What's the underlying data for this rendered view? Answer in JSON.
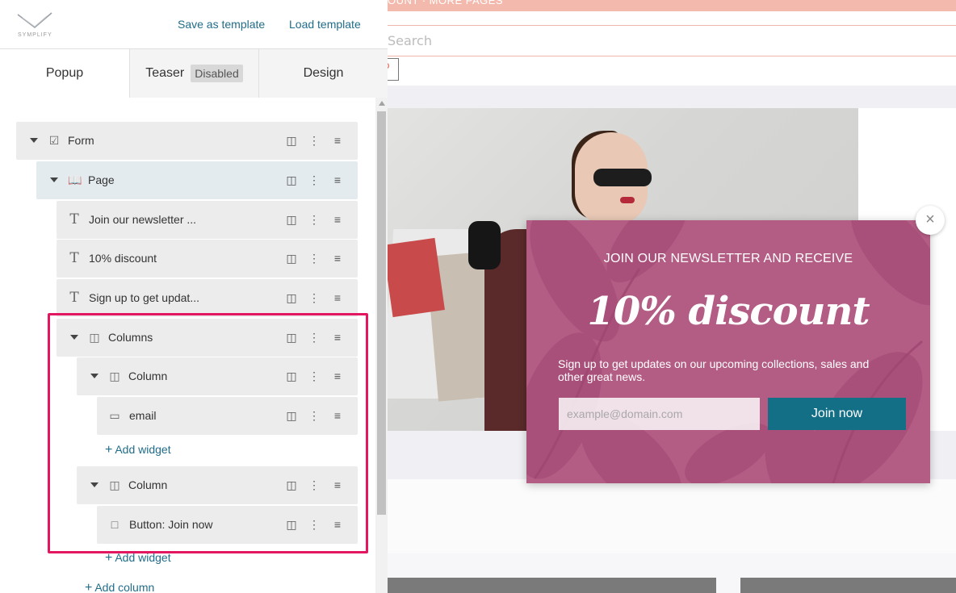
{
  "header": {
    "logo_text": "SYMPLIFY",
    "save_template": "Save as template",
    "load_template": "Load template"
  },
  "tabs": [
    {
      "label": "Popup"
    },
    {
      "label": "Teaser",
      "badge": "Disabled"
    },
    {
      "label": "Design"
    }
  ],
  "tree": {
    "form": "Form",
    "page": "Page",
    "text1": "Join our newsletter ...",
    "text2": "10% discount",
    "text3": "Sign up to get updat...",
    "columns": "Columns",
    "column1": "Column",
    "email": "email",
    "add_widget_1": "Add widget",
    "column2": "Column",
    "button": "Button: Join now",
    "add_widget_2": "Add widget",
    "add_column": "Add column"
  },
  "site": {
    "topbar_text": "OUNT · MORE PAGES",
    "search_placeholder": "Search"
  },
  "popup": {
    "heading": "JOIN OUR NEWSLETTER AND RECEIVE",
    "discount": "10% discount",
    "subtext": "Sign up to get updates on our upcoming collections, sales and other great news.",
    "email_placeholder": "example@domain.com",
    "button": "Join now",
    "close": "×"
  },
  "colors": {
    "accent_link": "#216d8a",
    "highlight": "#e3175f",
    "popup_bg": "#b35c84",
    "popup_button": "#136f86"
  }
}
